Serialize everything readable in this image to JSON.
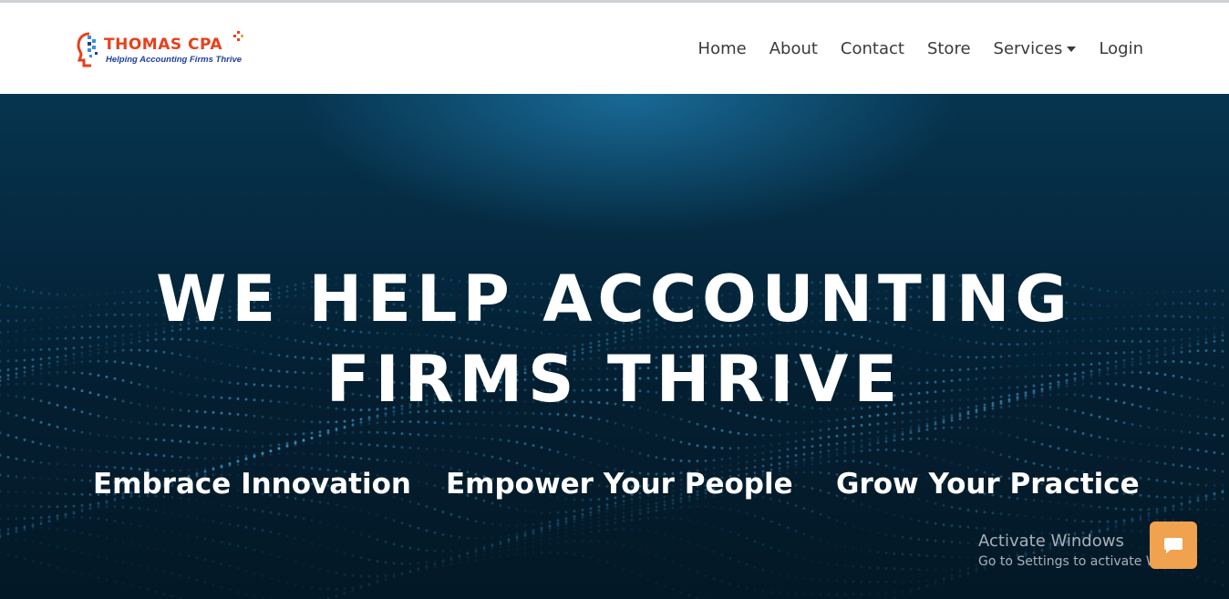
{
  "brand": {
    "name": "THOMAS CPA",
    "tagline": "Helping Accounting Firms Thrive",
    "name_color": "#e8401c",
    "tagline_color": "#1f3e9c"
  },
  "nav": {
    "items": [
      {
        "label": "Home"
      },
      {
        "label": "About"
      },
      {
        "label": "Contact"
      },
      {
        "label": "Store"
      },
      {
        "label": "Services",
        "dropdown": true
      },
      {
        "label": "Login"
      }
    ]
  },
  "hero": {
    "headline_line1": "WE HELP ACCOUNTING",
    "headline_line2": "FIRMS THRIVE",
    "pillars": [
      "Embrace Innovation",
      "Empower Your People",
      "Grow Your Practice"
    ]
  },
  "overlay": {
    "watermark_title": "Activate Windows",
    "watermark_subtitle": "Go to Settings to activate W",
    "chat_icon": "chat-bubble-icon",
    "chat_color": "#f0a24e"
  }
}
